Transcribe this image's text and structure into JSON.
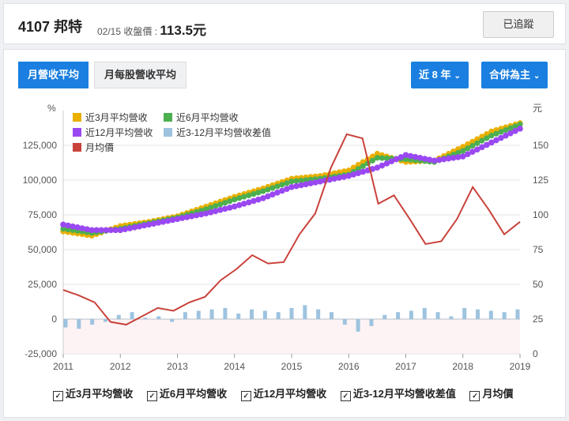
{
  "header": {
    "ticker": "4107 邦特",
    "close_label": "02/15 收盤價 :",
    "close_value": "113.5元",
    "track_button": "已追蹤"
  },
  "tabs": [
    "月營收平均",
    "月每股營收平均"
  ],
  "dropdowns": {
    "period": "近 8 年",
    "basis": "合併為主"
  },
  "bottom_legend": [
    "近3月平均營收",
    "近6月平均營收",
    "近12月平均營收",
    "近3-12月平均營收差值",
    "月均價"
  ],
  "colors": {
    "ma3": "#e9b000",
    "ma6": "#4caf50",
    "ma12": "#9a48f2",
    "diff": "#9dc3df",
    "price": "#c9423b"
  },
  "chart_data": {
    "type": "line",
    "x": [
      "2011",
      "2012",
      "2013",
      "2014",
      "2015",
      "2016",
      "2017",
      "2018",
      "2019"
    ],
    "left_axis": {
      "unit": "%",
      "ticks": [
        "125,000",
        "100,000",
        "75,000",
        "50,000",
        "25,000",
        "0",
        "-25,000"
      ],
      "range": [
        -25000,
        150000
      ]
    },
    "right_axis": {
      "unit": "元",
      "ticks": [
        "150",
        "125",
        "100",
        "75",
        "50",
        "25",
        "0"
      ],
      "range": [
        0,
        175
      ]
    },
    "legend": [
      "近3月平均營收",
      "近6月平均營收",
      "近12月平均營收",
      "近3-12月平均營收差值",
      "月均價"
    ],
    "series": [
      {
        "name": "近3月平均營收",
        "axis": "left",
        "values": [
          63000,
          60000,
          67000,
          70000,
          74000,
          81000,
          88000,
          94000,
          101000,
          103000,
          107000,
          119000,
          113000,
          114000,
          124000,
          135000,
          141000
        ]
      },
      {
        "name": "近6月平均營收",
        "axis": "left",
        "values": [
          65000,
          62000,
          65000,
          69000,
          73000,
          79000,
          86000,
          92000,
          99000,
          101000,
          104000,
          116000,
          115000,
          113000,
          121000,
          132000,
          140000
        ]
      },
      {
        "name": "近12月平均營收",
        "axis": "left",
        "values": [
          68000,
          64000,
          64000,
          68000,
          72000,
          76000,
          81000,
          87000,
          95000,
          99000,
          103000,
          109000,
          118000,
          114000,
          117000,
          127000,
          137000
        ]
      },
      {
        "name": "近3-12月平均營收差值",
        "axis": "left",
        "type": "bar",
        "values": [
          -6000,
          -7000,
          -4000,
          -2000,
          3000,
          5000,
          1000,
          2000,
          -2000,
          5000,
          6000,
          7000,
          8000,
          4000,
          7000,
          6000,
          5000,
          8000,
          10000,
          7000,
          5000,
          -4000,
          -9000,
          -5000,
          3000,
          5000,
          6000,
          8000,
          5000,
          2000,
          8000,
          7000,
          6000,
          5000,
          7000
        ]
      },
      {
        "name": "月均價",
        "axis": "right",
        "values": [
          46,
          42,
          37,
          23,
          21,
          27,
          33,
          31,
          37,
          41,
          53,
          61,
          71,
          65,
          66,
          86,
          101,
          134,
          158,
          155,
          108,
          114,
          97,
          79,
          81,
          97,
          120,
          104,
          86,
          95
        ]
      }
    ]
  }
}
